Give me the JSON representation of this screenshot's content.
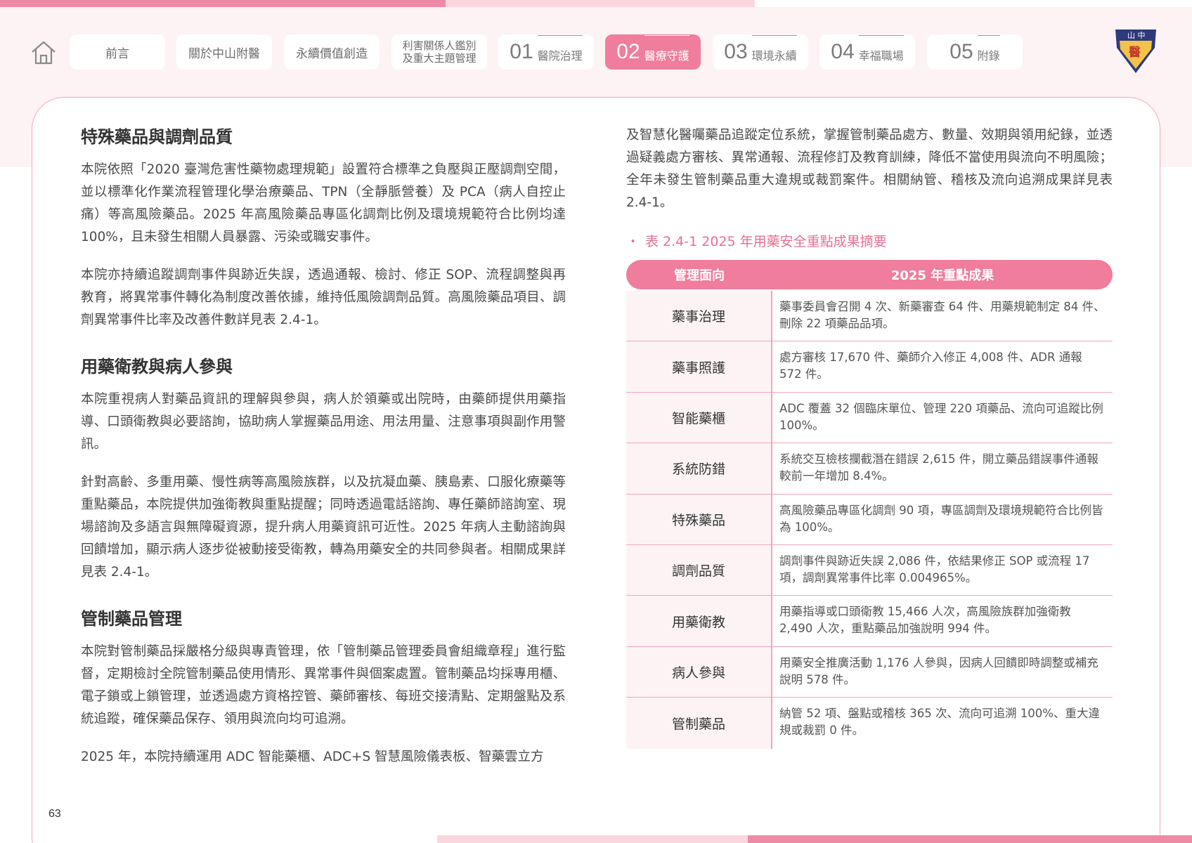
{
  "nav": {
    "items": [
      {
        "label": "前言"
      },
      {
        "label": "關於中山附醫"
      },
      {
        "label": "永續價值創造"
      },
      {
        "label_line1": "利害關係人鑑別",
        "label_line2": "及重大主題管理"
      },
      {
        "num": "01",
        "label": "醫院治理"
      },
      {
        "num": "02",
        "label": "醫療守護"
      },
      {
        "num": "03",
        "label": "環境永續"
      },
      {
        "num": "04",
        "label": "幸福職場"
      },
      {
        "num": "05",
        "label": "附錄"
      }
    ],
    "active_index": 5
  },
  "logo": {
    "text_top": "山 中",
    "text_mid": "醫"
  },
  "left": {
    "sections": [
      {
        "title": "特殊藥品與調劑品質",
        "paragraphs": [
          "本院依照「2020 臺灣危害性藥物處理規範」設置符合標準之負壓與正壓調劑空間，並以標準化作業流程管理化學治療藥品、TPN（全靜脈營養）及 PCA（病人自控止痛）等高風險藥品。2025 年高風險藥品專區化調劑比例及環境規範符合比例均達 100%，且未發生相關人員暴露、污染或職安事件。",
          "本院亦持續追蹤調劑事件與跡近失誤，透過通報、檢討、修正 SOP、流程調整與再教育，將異常事件轉化為制度改善依據，維持低風險調劑品質。高風險藥品項目、調劑異常事件比率及改善件數詳見表 2.4-1。"
        ]
      },
      {
        "title": "用藥衛教與病人參與",
        "paragraphs": [
          "本院重視病人對藥品資訊的理解與參與，病人於領藥或出院時，由藥師提供用藥指導、口頭衛教與必要諮詢，協助病人掌握藥品用途、用法用量、注意事項與副作用警訊。",
          "針對高齡、多重用藥、慢性病等高風險族群，以及抗凝血藥、胰島素、口服化療藥等重點藥品，本院提供加強衛教與重點提醒；同時透過電話諮詢、專任藥師諮詢室、現場諮詢及多語言與無障礙資源，提升病人用藥資訊可近性。2025 年病人主動諮詢與回饋增加，顯示病人逐步從被動接受衛教，轉為用藥安全的共同參與者。相關成果詳見表 2.4-1。"
        ]
      },
      {
        "title": "管制藥品管理",
        "paragraphs": [
          "本院對管制藥品採嚴格分級與專責管理，依「管制藥品管理委員會組織章程」進行監督，定期檢討全院管制藥品使用情形、異常事件與個案處置。管制藥品均採專用櫃、電子鎖或上鎖管理，並透過處方資格控管、藥師審核、每班交接清點、定期盤點及系統追蹤，確保藥品保存、領用與流向均可追溯。",
          "2025 年，本院持續運用 ADC 智能藥櫃、ADC+S 智慧風險儀表板、智藥雲立方"
        ]
      }
    ]
  },
  "right": {
    "intro": "及智慧化醫囑藥品追蹤定位系統，掌握管制藥品處方、數量、效期與領用紀錄，並透過疑義處方審核、異常通報、流程修訂及教育訓練，降低不當使用與流向不明風險；全年未發生管制藥品重大違規或裁罰案件。相關納管、稽核及流向追溯成果詳見表 2.4-1。",
    "caption_dot": "・",
    "caption": "表 2.4-1 2025 年用藥安全重點成果摘要",
    "table": {
      "header": {
        "col1": "管理面向",
        "col2": "2025 年重點成果"
      },
      "rows": [
        {
          "aspect": "藥事治理",
          "result": "藥事委員會召開 4 次、新藥審查 64 件、用藥規範制定 84 件、刪除 22 項藥品品項。"
        },
        {
          "aspect": "藥事照護",
          "result": "處方審核 17,670 件、藥師介入修正 4,008 件、ADR 通報 572 件。"
        },
        {
          "aspect": "智能藥櫃",
          "result": "ADC 覆蓋 32 個臨床單位、管理 220 項藥品、流向可追蹤比例 100%。"
        },
        {
          "aspect": "系統防錯",
          "result": "系統交互檢核攔截潛在錯誤 2,615 件，開立藥品錯誤事件通報較前一年增加 8.4%。"
        },
        {
          "aspect": "特殊藥品",
          "result": "高風險藥品專區化調劑 90 項，專區調劑及環境規範符合比例皆為 100%。"
        },
        {
          "aspect": "調劑品質",
          "result": "調劑事件與跡近失誤 2,086 件，依結果修正 SOP 或流程 17 項，調劑異常事件比率 0.004965%。"
        },
        {
          "aspect": "用藥衛教",
          "result": "用藥指導或口頭衛教 15,466 人次，高風險族群加強衛教 2,490 人次，重點藥品加強說明 994 件。"
        },
        {
          "aspect": "病人參與",
          "result": "用藥安全推廣活動 1,176 人參與，因病人回饋即時調整或補充說明 578 件。"
        },
        {
          "aspect": "管制藥品",
          "result": "納管 52 項、盤點或稽核 365 次、流向可追溯 100%、重大違規或裁罰 0 件。"
        }
      ]
    }
  },
  "footer": {
    "page_number": "63"
  },
  "colors": {
    "accent": "#ef7d9b",
    "accent_light": "#fbd6df",
    "header_bg": "#fdf2f4",
    "caption": "#e96f91"
  }
}
